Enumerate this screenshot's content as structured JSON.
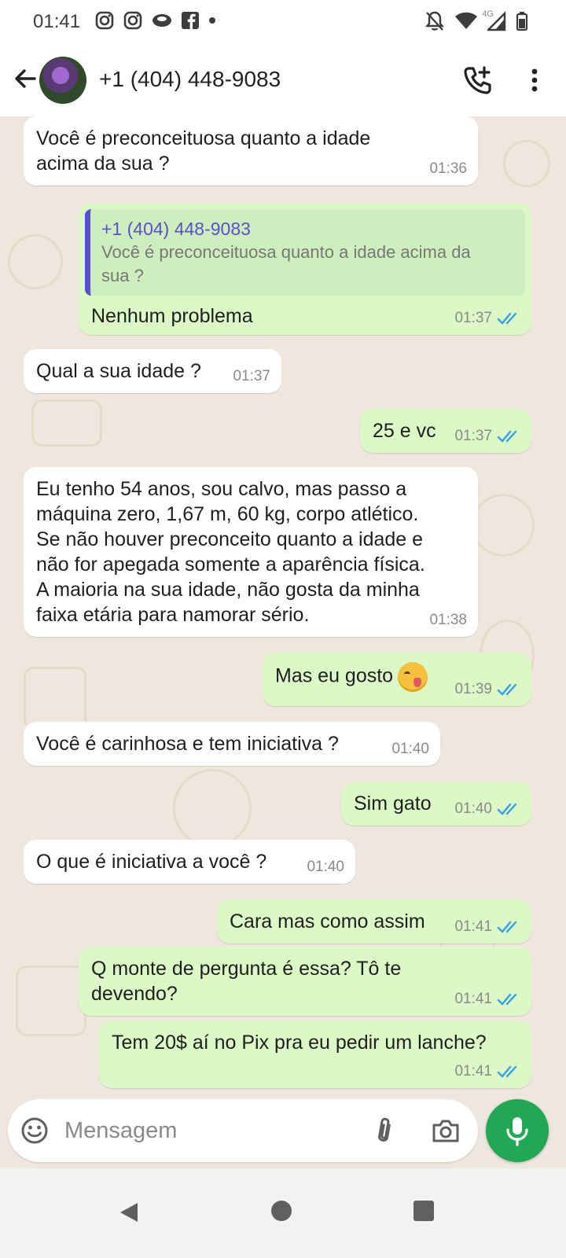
{
  "status_bar": {
    "time": "01:41",
    "network_label": "4G",
    "left_icons": [
      "instagram-icon",
      "instagram-icon",
      "eye-app-icon",
      "facebook-icon",
      "dot-icon"
    ],
    "right_icons": [
      "notifications-off-icon",
      "wifi-icon",
      "signal-icon",
      "battery-icon"
    ]
  },
  "header": {
    "contact": "+1 (404) 448-9083",
    "icons": [
      "back-arrow-icon",
      "add-call-icon",
      "more-vert-icon"
    ]
  },
  "messages": [
    {
      "direction": "in",
      "text": "Você é preconceituosa quanto a idade\nacima da sua ?",
      "time": "01:36"
    },
    {
      "direction": "out",
      "quote_author": "+1 (404) 448-9083",
      "quote_text": "Você é preconceituosa quanto a idade acima da\nsua ?",
      "text": "Nenhum problema",
      "time": "01:37",
      "status": "read"
    },
    {
      "direction": "in",
      "text": "Qual a sua idade ?",
      "time": "01:37"
    },
    {
      "direction": "out",
      "text": "25 e vc",
      "time": "01:37",
      "status": "read"
    },
    {
      "direction": "in",
      "text": "Eu tenho 54 anos, sou calvo, mas passo a\nmáquina zero, 1,67 m, 60 kg, corpo atlético.\nSe não houver preconceito quanto a idade e\nnão for apegada somente a aparência física.\nA maioria na sua idade, não gosta da minha\nfaixa etária para namorar sério.",
      "time": "01:38"
    },
    {
      "direction": "out",
      "text": "Mas eu gosto",
      "emoji": "face-savoring-food",
      "time": "01:39",
      "status": "read"
    },
    {
      "direction": "in",
      "text": "Você é carinhosa e tem iniciativa ?",
      "time": "01:40"
    },
    {
      "direction": "out",
      "text": "Sim gato",
      "time": "01:40",
      "status": "read"
    },
    {
      "direction": "in",
      "text": "O que é iniciativa a você ?",
      "time": "01:40"
    },
    {
      "direction": "out",
      "text": "Cara mas como assim",
      "time": "01:41",
      "status": "read"
    },
    {
      "direction": "out",
      "text": "Q monte de pergunta é essa? Tô te\ndevendo?",
      "time": "01:41",
      "status": "read"
    },
    {
      "direction": "out",
      "text": "Tem 20$ aí no Pix pra eu pedir um lanche?",
      "time": "01:41",
      "status": "read"
    }
  ],
  "composer": {
    "placeholder": "Mensagem",
    "icons": [
      "emoji-icon",
      "attach-icon",
      "camera-icon",
      "mic-icon"
    ]
  },
  "colors": {
    "chat_background": "#efe7dd",
    "incoming_bubble": "#ffffff",
    "outgoing_bubble": "#dcf8c6",
    "quote_accent": "#5a4fd0",
    "read_ticks": "#34a0e8",
    "mic_button": "#20a855"
  },
  "nav_bar": {
    "icons": [
      "nav-back-icon",
      "nav-home-icon",
      "nav-recents-icon"
    ]
  }
}
